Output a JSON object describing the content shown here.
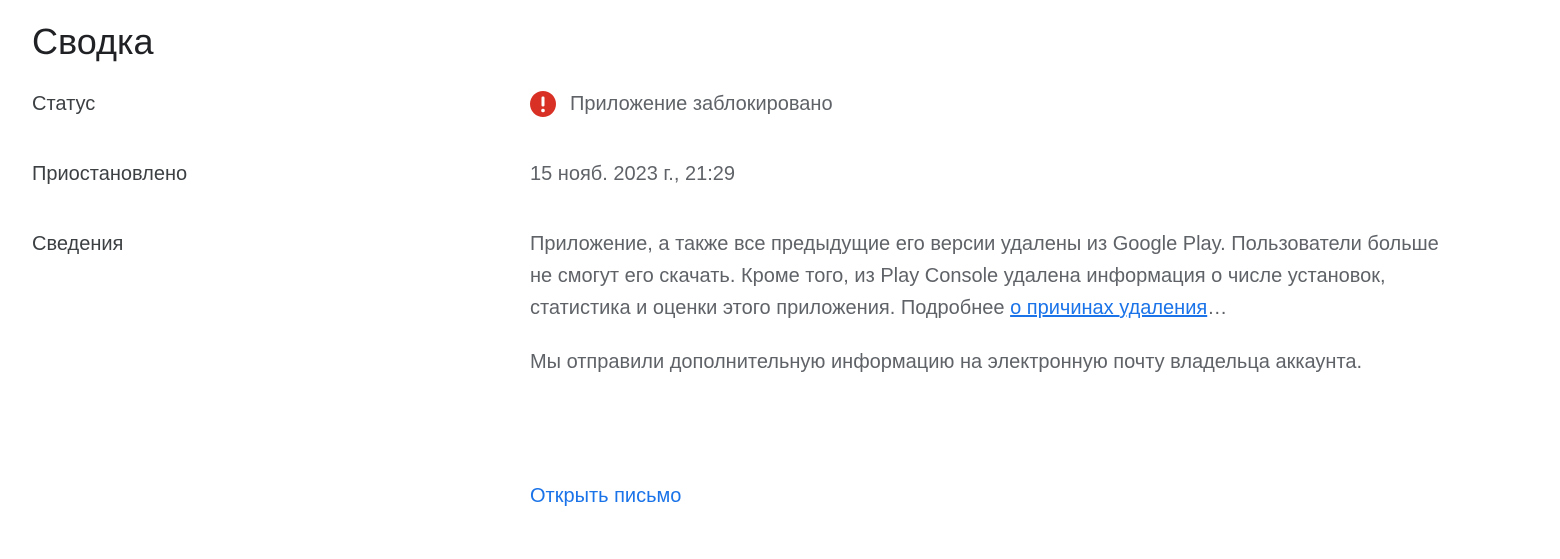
{
  "summary": {
    "title": "Сводка",
    "status": {
      "label": "Статус",
      "value": "Приложение заблокировано",
      "icon": "error-icon",
      "icon_color": "#d93025"
    },
    "suspended": {
      "label": "Приостановлено",
      "value": "15 нояб. 2023 г., 21:29"
    },
    "details": {
      "label": "Сведения",
      "paragraph1_text": "Приложение, а также все предыдущие его версии удалены из Google Play. Пользователи больше не смогут его скачать. Кроме того, из Play Console удалена информация о числе установок, статистика и оценки этого приложения. Подробнее ",
      "paragraph1_link": "о причинах удаления",
      "paragraph1_suffix": "…",
      "paragraph2": "Мы отправили дополнительную информацию на электронную почту владельца аккаунта.",
      "open_email_label": "Открыть письмо"
    }
  },
  "colors": {
    "link": "#1a73e8",
    "label_text": "#3c4043",
    "value_text": "#5f6368",
    "title_text": "#202124"
  }
}
